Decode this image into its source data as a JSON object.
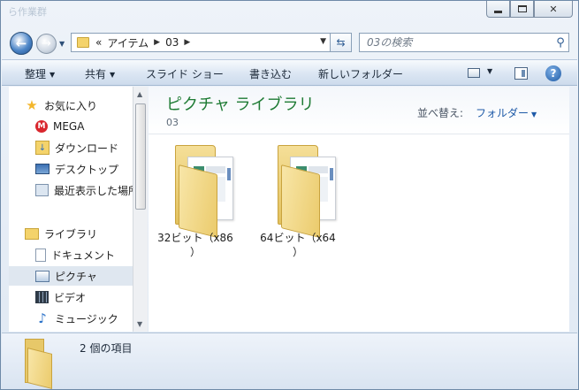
{
  "window": {
    "ghost_title": "ら作業群",
    "caption": {
      "minimize": "minimize-icon",
      "maximize": "maximize-icon",
      "close": "✕"
    }
  },
  "nav": {
    "back_glyph": "←",
    "forward_glyph": "→",
    "history_glyph": "▼",
    "breadcrumb": [
      "«",
      "アイテム",
      "03"
    ],
    "crumb_sep": "▶",
    "address_drop": "▼",
    "refresh_glyph": "⇆",
    "search_placeholder": "03の検索",
    "search_glyph": "⚲"
  },
  "toolbar": {
    "items": [
      {
        "label": "整理",
        "arrow": "▼"
      },
      {
        "label": "共有",
        "arrow": "▼"
      },
      {
        "label": "スライド ショー"
      },
      {
        "label": "書き込む"
      },
      {
        "label": "新しいフォルダー"
      }
    ],
    "view_arrow": "▼",
    "help_glyph": "?"
  },
  "sidebar": {
    "favorites": [
      {
        "label": "お気に入り",
        "icon": "star-icon"
      },
      {
        "label": "MEGA",
        "icon": "mega-icon",
        "glyph": "M"
      },
      {
        "label": "ダウンロード",
        "icon": "download-folder-icon",
        "glyph": "↓"
      },
      {
        "label": "デスクトップ",
        "icon": "desktop-icon"
      },
      {
        "label": "最近表示した場所",
        "icon": "recent-places-icon"
      }
    ],
    "libraries": [
      {
        "label": "ライブラリ",
        "icon": "library-icon"
      },
      {
        "label": "ドキュメント",
        "icon": "documents-icon"
      },
      {
        "label": "ピクチャ",
        "icon": "pictures-icon",
        "selected": true
      },
      {
        "label": "ビデオ",
        "icon": "video-icon"
      },
      {
        "label": "ミュージック",
        "icon": "music-icon",
        "glyph": "♪"
      }
    ],
    "scroll_up": "▲",
    "scroll_down": "▼"
  },
  "library": {
    "title": "ピクチャ ライブラリ",
    "subtitle": "03",
    "arrange_label": "並べ替え:",
    "arrange_value": "フォルダー",
    "arrange_arrow": "▼",
    "folders": [
      {
        "name": "32ビット（x86\n）"
      },
      {
        "name": "64ビット（x64\n）"
      }
    ]
  },
  "details": {
    "count_text": "2 個の項目"
  },
  "colors": {
    "library_title": "#1e7b34",
    "link_blue": "#1e5aa8",
    "selection": "#dfe7f0"
  }
}
